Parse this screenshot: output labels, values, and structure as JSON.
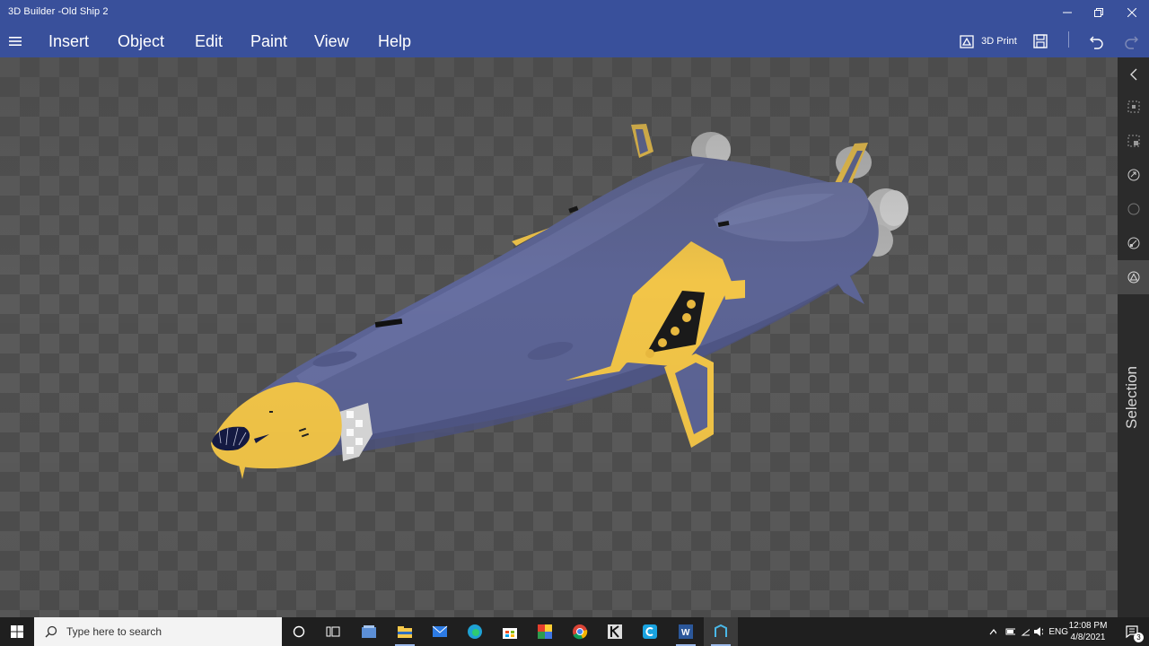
{
  "window": {
    "title": "3D Builder -Old Ship 2"
  },
  "menu": {
    "items": [
      "Insert",
      "Object",
      "Edit",
      "Paint",
      "View",
      "Help"
    ]
  },
  "toolbar": {
    "print_label": "3D Print"
  },
  "side_panel": {
    "label": "Selection"
  },
  "taskbar": {
    "search_placeholder": "Type here to search",
    "language": "ENG",
    "time": "12:08 PM",
    "date": "4/8/2021",
    "notification_count": "3"
  },
  "colors": {
    "accent": "#39509b",
    "hull": "#5c6495",
    "trim": "#f2c548",
    "panel": "#2b2b2b",
    "taskbar": "#1f1f1f"
  }
}
